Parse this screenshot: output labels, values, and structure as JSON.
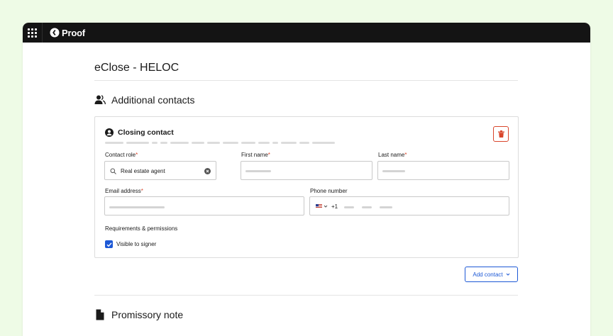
{
  "app": {
    "name": "Proof"
  },
  "page": {
    "title": "eClose - HELOC"
  },
  "additional_contacts": {
    "title": "Additional contacts",
    "card": {
      "title": "Closing contact",
      "fields": {
        "contact_role": {
          "label": "Contact role",
          "value": "Real estate agent"
        },
        "first_name": {
          "label": "First name"
        },
        "last_name": {
          "label": "Last name"
        },
        "email": {
          "label": "Email address"
        },
        "phone": {
          "label": "Phone number",
          "country_code": "+1"
        }
      },
      "requirements_label": "Requirements & permissions",
      "visible_to_signer": {
        "label": "Visible to signer",
        "checked": true
      }
    },
    "add_button": "Add contact"
  },
  "promissory_note": {
    "title": "Promissory note"
  },
  "colors": {
    "accent": "#1d59d6",
    "danger": "#d9452b",
    "background": "#eefbe6",
    "topbar": "#141414"
  }
}
